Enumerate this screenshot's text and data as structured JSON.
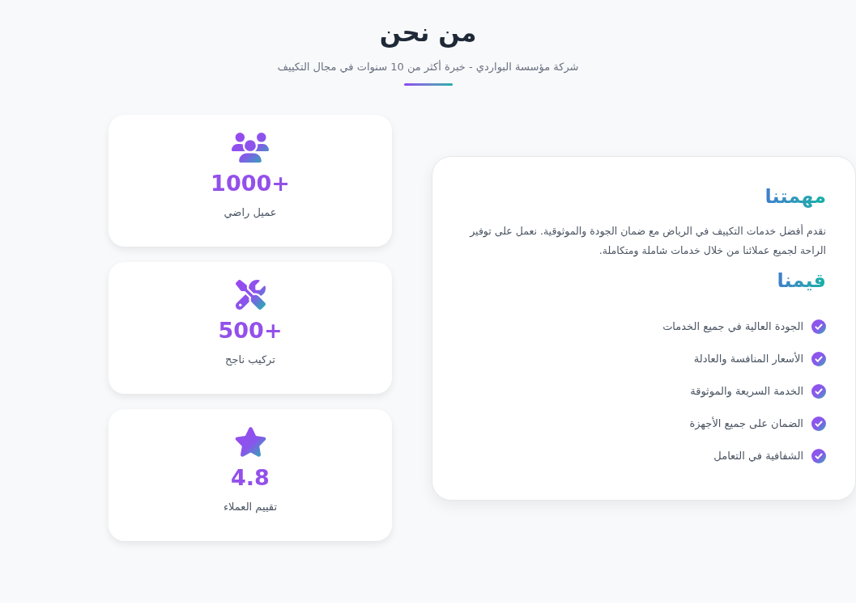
{
  "section": {
    "title": "من نحن",
    "subtitle": "شركة مؤسسة البواردي - خبرة أكثر من 10 سنوات في مجال التكييف"
  },
  "stats": [
    {
      "value": "1000+",
      "label": "عميل راضي"
    },
    {
      "value": "500+",
      "label": "تركيب ناجح"
    },
    {
      "value": "4.8",
      "label": "تقييم العملاء"
    }
  ],
  "about": {
    "mission_title": "مهمتنا",
    "mission_text": "نقدم أفضل خدمات التكييف في الرياض مع ضمان الجودة والموثوقية. نعمل على توفير الراحة لجميع عملائنا من خلال خدمات شاملة ومتكاملة.",
    "values_title": "قيمنا",
    "values": [
      "الجودة العالية في جميع الخدمات",
      "الأسعار المنافسة والعادلة",
      "الخدمة السريعة والموثوقة",
      "الضمان على جميع الأجهزة",
      "الشفافية في التعامل"
    ]
  }
}
